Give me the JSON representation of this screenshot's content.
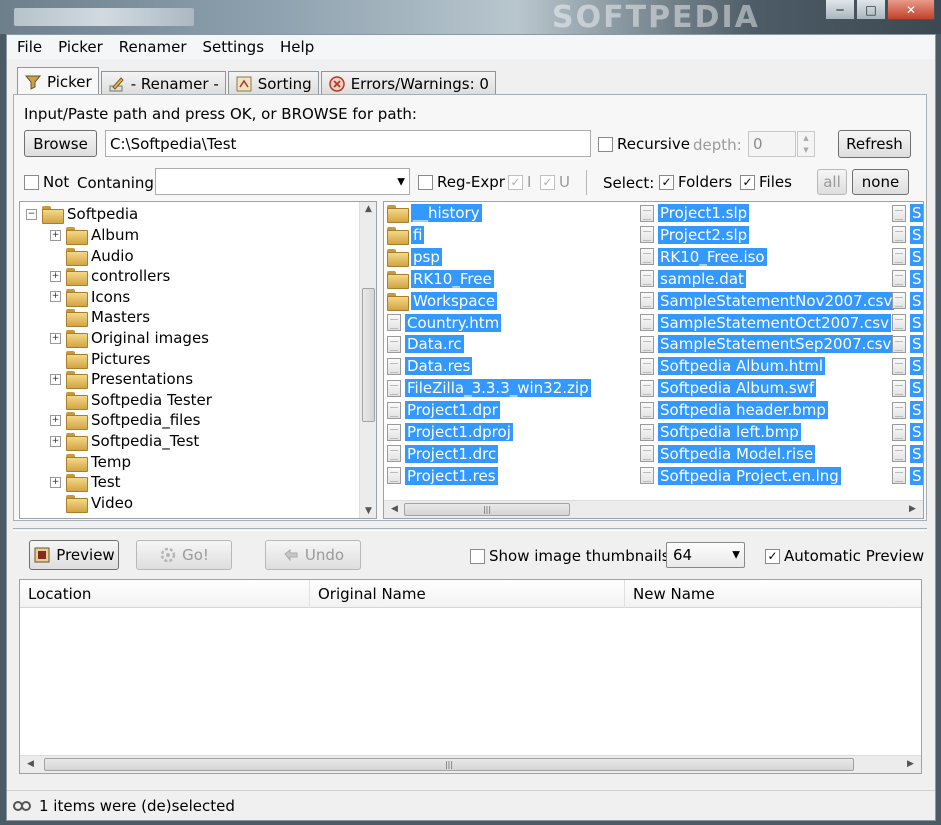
{
  "window": {
    "watermark": "SOFTPEDIA"
  },
  "menu": [
    "File",
    "Picker",
    "Renamer",
    "Settings",
    "Help"
  ],
  "tabs": [
    {
      "label": "Picker",
      "icon": "funnel-icon"
    },
    {
      "label": "- Renamer -",
      "icon": "pencil-icon"
    },
    {
      "label": "Sorting",
      "icon": "sort-icon"
    },
    {
      "label": "Errors/Warnings: 0",
      "icon": "error-icon"
    }
  ],
  "picker": {
    "path_prompt": "Input/Paste path and press OK, or BROWSE for path:",
    "browse_label": "Browse",
    "path_value": "C:\\Softpedia\\Test",
    "recursive_label": "Recursive",
    "depth_label": "depth:",
    "depth_value": "0",
    "refresh_label": "Refresh",
    "not_label": "Not",
    "containing_label": "Contaning:",
    "containing_value": "",
    "regexpr_label": "Reg-Expr",
    "i_label": "I",
    "u_label": "U",
    "select_label": "Select:",
    "folders_label": "Folders",
    "files_label": "Files",
    "all_label": "all",
    "none_label": "none"
  },
  "tree": {
    "root": "Softpedia",
    "items": [
      {
        "label": "Album",
        "expandable": true
      },
      {
        "label": "Audio",
        "expandable": false
      },
      {
        "label": "controllers",
        "expandable": true
      },
      {
        "label": "Icons",
        "expandable": true
      },
      {
        "label": "Masters",
        "expandable": false
      },
      {
        "label": "Original images",
        "expandable": true
      },
      {
        "label": "Pictures",
        "expandable": false
      },
      {
        "label": "Presentations",
        "expandable": true
      },
      {
        "label": "Softpedia Tester",
        "expandable": false
      },
      {
        "label": "Softpedia_files",
        "expandable": true
      },
      {
        "label": "Softpedia_Test",
        "expandable": true
      },
      {
        "label": "Temp",
        "expandable": false
      },
      {
        "label": "Test",
        "expandable": true
      },
      {
        "label": "Video",
        "expandable": false
      }
    ]
  },
  "files": {
    "col1": [
      {
        "name": "__history",
        "type": "folder"
      },
      {
        "name": "fi",
        "type": "folder"
      },
      {
        "name": "psp",
        "type": "folder"
      },
      {
        "name": "RK10_Free",
        "type": "folder"
      },
      {
        "name": "Workspace",
        "type": "folder"
      },
      {
        "name": "Country.htm",
        "type": "file"
      },
      {
        "name": "Data.rc",
        "type": "file"
      },
      {
        "name": "Data.res",
        "type": "file"
      },
      {
        "name": "FileZilla_3.3.3_win32.zip",
        "type": "file"
      },
      {
        "name": "Project1.dpr",
        "type": "file"
      },
      {
        "name": "Project1.dproj",
        "type": "file"
      },
      {
        "name": "Project1.drc",
        "type": "file"
      },
      {
        "name": "Project1.res",
        "type": "file"
      }
    ],
    "col2": [
      "Project1.slp",
      "Project2.slp",
      "RK10_Free.iso",
      "sample.dat",
      "SampleStatementNov2007.csv",
      "SampleStatementOct2007.csv",
      "SampleStatementSep2007.csv",
      "Softpedia Album.html",
      "Softpedia Album.swf",
      "Softpedia header.bmp",
      "Softpedia left.bmp",
      "Softpedia Model.rise",
      "Softpedia Project.en.lng"
    ],
    "col3_partial": [
      "S",
      "S",
      "S",
      "S",
      "S",
      "S",
      "S",
      "S",
      "S",
      "S",
      "S",
      "S",
      "S"
    ]
  },
  "actions": {
    "preview_label": "Preview",
    "go_label": "Go!",
    "undo_label": "Undo",
    "thumbnails_label": "Show image thumbnails",
    "thumb_size": "64",
    "auto_preview_label": "Automatic Preview"
  },
  "grid": {
    "columns": [
      "Location",
      "Original Name",
      "New Name"
    ]
  },
  "status": {
    "text": "1 items were (de)selected"
  }
}
